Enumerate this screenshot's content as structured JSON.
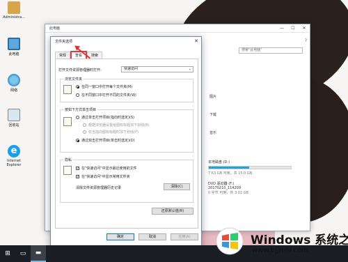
{
  "desktop": {
    "icons": [
      {
        "label": "Administra...",
        "icon": "user-folder-icon"
      },
      {
        "label": "此电脑",
        "icon": "computer-icon"
      },
      {
        "label": "网络",
        "icon": "network-icon"
      },
      {
        "label": "回收站",
        "icon": "recycle-bin-icon"
      },
      {
        "label": "Internet Explorer",
        "icon": "ie-icon"
      }
    ]
  },
  "explorer": {
    "title": "此电脑",
    "search_placeholder": "搜索\"此电脑\"",
    "side_items": [
      "图片",
      "下载",
      "音乐"
    ],
    "drives": [
      {
        "name": "本地磁盘 (D:)",
        "detail": "7.63 GB 可用，共 15.0 GB",
        "fill": 0.49
      },
      {
        "name": "DVD 驱动器 (F:)",
        "label": "20170210_114209",
        "detail": "0 字节 可用，共 3.02 GB"
      }
    ]
  },
  "dialog": {
    "title": "文件夹选项",
    "close": "✕",
    "tabs": [
      "常规",
      "查看",
      "搜索"
    ],
    "open_with_label": "打开文件资源管理器时打开:",
    "open_with_value": "快速访问",
    "browse_group": {
      "legend": "浏览文件夹",
      "options": [
        "在同一窗口中打开每个文件夹(M)",
        "在不同窗口中打开不同的文件夹(W)"
      ]
    },
    "click_group": {
      "legend": "按如下方式单击项目",
      "options": [
        "通过单击打开项目(指向时选定)(S)",
        "根据浏览器设置给图标标题加下划线(B)",
        "仅当指向图标标题时加下划线(P)",
        "通过双击打开项目(单击时选定)(D)"
      ]
    },
    "privacy_group": {
      "legend": "隐私",
      "checks": [
        "在\"快速访问\"中显示最近使用的文件",
        "在\"快速访问\"中显示常用文件夹"
      ],
      "clear_label": "清除文件资源管理器历史记录",
      "clear_button": "清除(C)"
    },
    "restore_button": "还原默认值(R)",
    "buttons": {
      "ok": "确定",
      "cancel": "取消",
      "apply": "应用(A)"
    }
  },
  "watermark": {
    "brand": "Windows",
    "brand_suffix": "系统之家",
    "url": "www.bjjmlv.com",
    "colors": [
      "#e74c3c",
      "#2ecc71",
      "#3498db",
      "#f1c40f"
    ]
  }
}
